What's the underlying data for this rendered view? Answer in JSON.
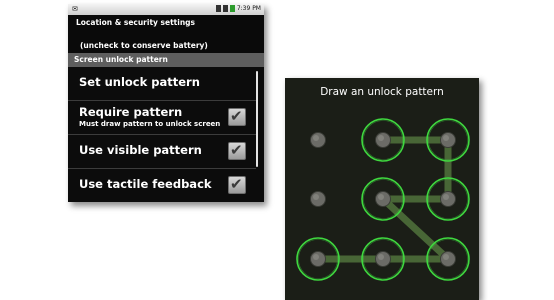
{
  "settings": {
    "statusbar": {
      "time": "7:39 PM"
    },
    "header": {
      "title": "Location & security settings",
      "subtitle": "(uncheck to conserve battery)"
    },
    "category": "Screen unlock pattern",
    "items": [
      {
        "title": "Set unlock pattern",
        "summary": "",
        "has_checkbox": false
      },
      {
        "title": "Require pattern",
        "summary": "Must draw pattern to unlock screen",
        "has_checkbox": true,
        "checked": true
      },
      {
        "title": "Use visible pattern",
        "summary": "",
        "has_checkbox": true,
        "checked": true
      },
      {
        "title": "Use tactile feedback",
        "summary": "",
        "has_checkbox": true,
        "checked": true
      }
    ]
  },
  "pattern": {
    "title": "Draw an unlock pattern",
    "selected_nodes": [
      2,
      3,
      6,
      5,
      9,
      8,
      7
    ],
    "colors": {
      "background": "#1b1e17",
      "ring": "#3fd83f",
      "line": "#4d6e3a",
      "dot": "#6b6b66"
    }
  }
}
